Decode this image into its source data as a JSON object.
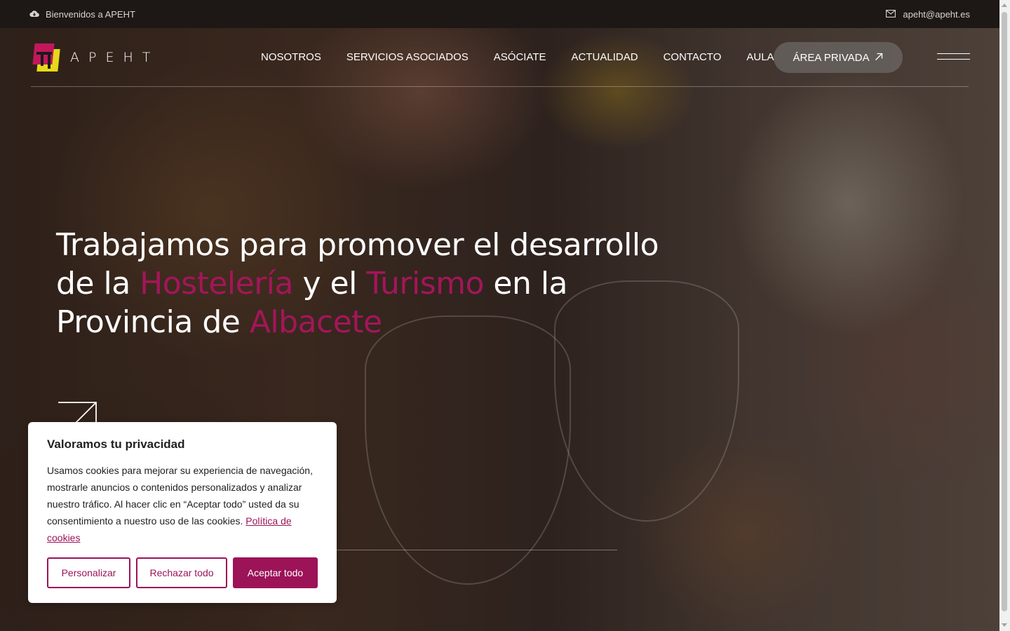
{
  "topbar": {
    "welcome": "Bienvenidos a APEHT",
    "email": "apeht@apeht.es"
  },
  "header": {
    "logo_text": "APEHT",
    "nav": [
      "NOSOTROS",
      "SERVICIOS ASOCIADOS",
      "ASÓCIATE",
      "ACTUALIDAD",
      "CONTACTO",
      "AULA"
    ],
    "private_area": "ÁREA PRIVADA"
  },
  "hero": {
    "line1": "Trabajamos para promover el desarrollo",
    "line2_a": "de la ",
    "line2_accent1": "Hostelería",
    "line2_b": " y el ",
    "line2_accent2": "Turismo",
    "line2_c": " en la",
    "line3_a": "Provincia de ",
    "line3_accent": "Albacete"
  },
  "cookie": {
    "title": "Valoramos tu privacidad",
    "text": "Usamos cookies para mejorar su experiencia de navegación, mostrarle anuncios o contenidos personalizados y analizar nuestro tráfico. Al hacer clic en “Aceptar todo” usted da su consentimiento a nuestro uso de las cookies.",
    "policy_link": "Política de cookies",
    "buttons": {
      "customize": "Personalizar",
      "reject": "Rechazar todo",
      "accept": "Aceptar todo"
    }
  },
  "colors": {
    "accent": "#9c1358",
    "accent_text": "#a3165a",
    "topbar": "#1d1716",
    "logo_magenta": "#c2185b",
    "logo_yellow": "#e8d81a"
  },
  "icons": {
    "welcome": "cloud-download-icon",
    "email": "envelope-icon",
    "private_area": "arrow-up-right-icon",
    "menu": "hamburger-icon",
    "hero": "arrow-up-right-icon"
  }
}
